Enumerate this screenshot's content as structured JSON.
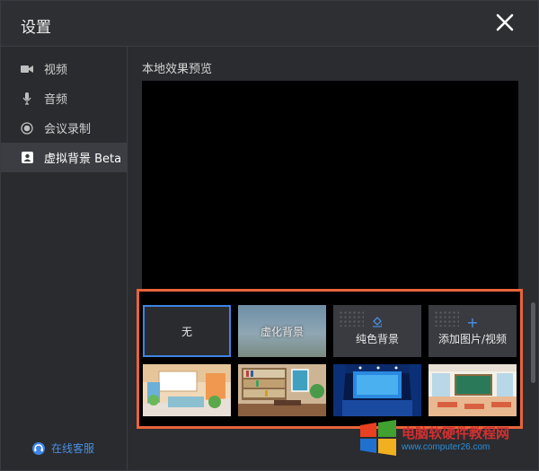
{
  "window": {
    "title": "设置"
  },
  "sidebar": {
    "items": [
      {
        "label": "视频",
        "icon": "video-camera-icon"
      },
      {
        "label": "音频",
        "icon": "microphone-icon"
      },
      {
        "label": "会议录制",
        "icon": "record-icon"
      },
      {
        "label": "虚拟背景 Beta",
        "icon": "portrait-icon",
        "active": true
      }
    ],
    "support_label": "在线客服"
  },
  "main": {
    "preview_label": "本地效果预览",
    "backgrounds": [
      {
        "label": "无",
        "selected": true
      },
      {
        "label": "虚化背景"
      },
      {
        "label": "纯色背景"
      },
      {
        "label": "添加图片/视频"
      }
    ],
    "images": [
      "bedroom-background",
      "bookshelf-background",
      "stage-background",
      "classroom-background"
    ]
  },
  "watermark": {
    "text": "电脑软硬件教程网",
    "url": "www.computer26.com"
  },
  "colors": {
    "accent": "#3d84e6",
    "highlight_box": "#e8643a"
  }
}
